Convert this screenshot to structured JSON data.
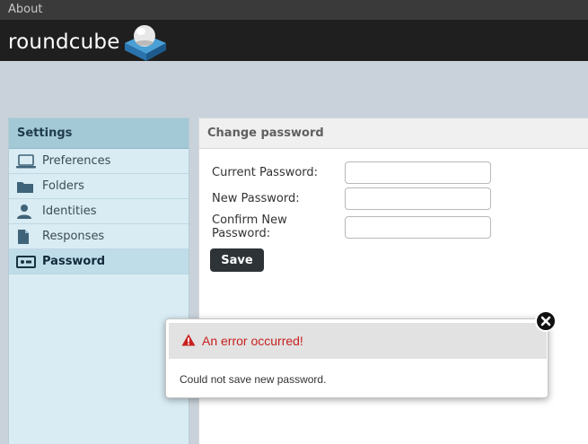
{
  "topbar": {
    "about_label": "About"
  },
  "header": {
    "logo_text": "roundcube"
  },
  "sidebar": {
    "title": "Settings",
    "items": [
      {
        "label": "Preferences",
        "icon": "laptop-icon",
        "selected": false
      },
      {
        "label": "Folders",
        "icon": "folder-icon",
        "selected": false
      },
      {
        "label": "Identities",
        "icon": "person-icon",
        "selected": false
      },
      {
        "label": "Responses",
        "icon": "document-icon",
        "selected": false
      },
      {
        "label": "Password",
        "icon": "password-icon",
        "selected": true
      }
    ]
  },
  "main": {
    "title": "Change password",
    "fields": [
      {
        "label": "Current Password:",
        "value": "",
        "placeholder": ""
      },
      {
        "label": "New Password:",
        "value": "",
        "placeholder": ""
      },
      {
        "label": "Confirm New Password:",
        "value": "",
        "placeholder": ""
      }
    ],
    "save_label": "Save"
  },
  "dialog": {
    "title": "An error occurred!",
    "message": "Could not save new password.",
    "close_icon": "close-icon"
  },
  "colors": {
    "accent": "#c82020",
    "sidebar_header": "#a3c9d6",
    "sidebar_bg": "#d9ecf4",
    "header_bg": "#1f1f1f",
    "button_bg": "#2e3338"
  }
}
